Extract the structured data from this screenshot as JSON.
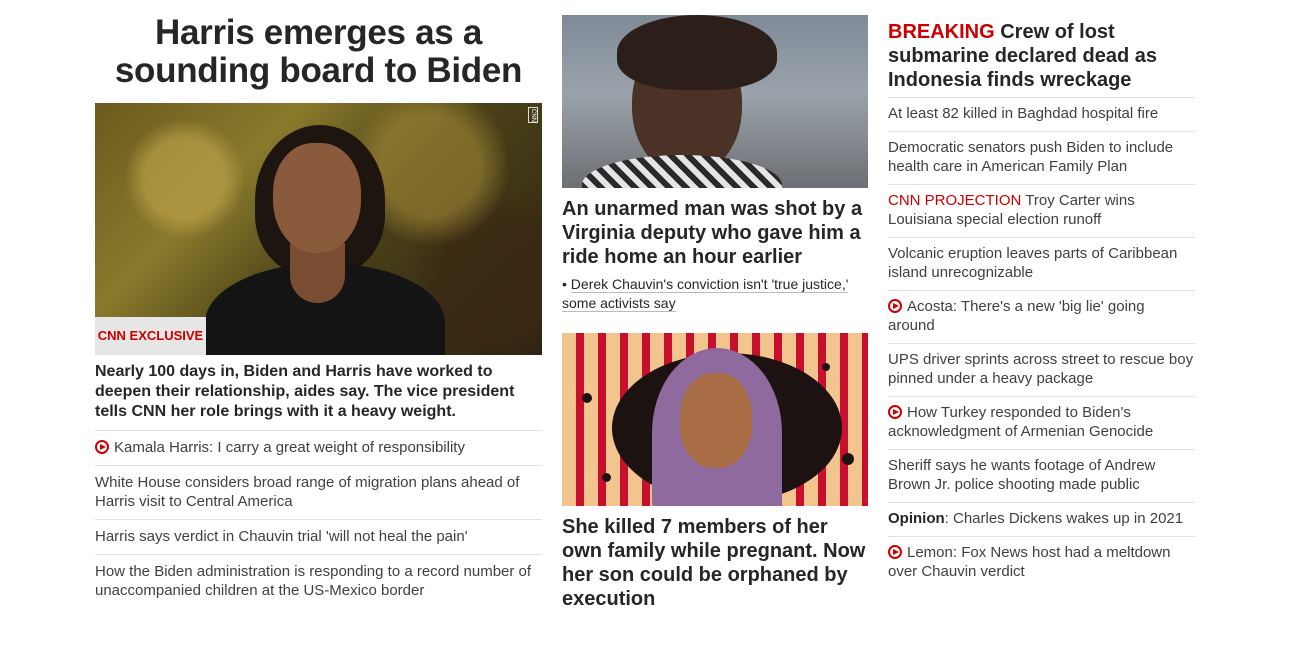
{
  "lead": {
    "headline": "Harris emerges as a sounding board to Biden",
    "image_label": "CNN EXCLUSIVE",
    "image_bug": "CNN",
    "summary": "Nearly 100 days in, Biden and Harris have worked to deepen their relationship, aides say. The vice president tells CNN her role brings with it a heavy weight.",
    "related": [
      {
        "text": "Kamala Harris: I carry a great weight of responsibility",
        "video": true
      },
      {
        "text": "White House considers broad range of migration plans ahead of Harris visit to Central America",
        "video": false
      },
      {
        "text": "Harris says verdict in Chauvin trial 'will not heal the pain'",
        "video": false
      },
      {
        "text": "How the Biden administration is responding to a record number of unaccompanied children at the US-Mexico border",
        "video": false
      }
    ]
  },
  "middle": {
    "story1": {
      "headline": "An unarmed man was shot by a Virginia deputy who gave him a ride home an hour earlier",
      "sub_bullet": "•",
      "sub_link": "Derek Chauvin's conviction isn't 'true justice,' some activists say"
    },
    "story2": {
      "headline": "She killed 7 members of her own family while pregnant. Now her son could be orphaned by execution"
    }
  },
  "right": {
    "breaking_label": "BREAKING",
    "breaking_headline": "Crew of lost submarine declared dead as Indonesia finds wreckage",
    "items": [
      {
        "prefix": "",
        "prefix_style": "",
        "text": "At least 82 killed in Baghdad hospital fire",
        "video": false
      },
      {
        "prefix": "",
        "prefix_style": "",
        "text": "Democratic senators push Biden to include health care in American Family Plan",
        "video": false
      },
      {
        "prefix": "CNN PROJECTION",
        "prefix_style": "red",
        "text": "Troy Carter wins Louisiana special election runoff",
        "video": false
      },
      {
        "prefix": "",
        "prefix_style": "",
        "text": "Volcanic eruption leaves parts of Caribbean island unrecognizable",
        "video": false
      },
      {
        "prefix": "",
        "prefix_style": "",
        "text": "Acosta: There's a new 'big lie' going around",
        "video": true
      },
      {
        "prefix": "",
        "prefix_style": "",
        "text": "UPS driver sprints across street to rescue boy pinned under a heavy package",
        "video": false
      },
      {
        "prefix": "",
        "prefix_style": "",
        "text": "How Turkey responded to Biden's acknowledgment of Armenian Genocide",
        "video": true
      },
      {
        "prefix": "",
        "prefix_style": "",
        "text": "Sheriff says he wants footage of Andrew Brown Jr. police shooting made public",
        "video": false
      },
      {
        "prefix": "Opinion",
        "prefix_style": "bold",
        "text": ": Charles Dickens wakes up in 2021",
        "video": false
      },
      {
        "prefix": "",
        "prefix_style": "",
        "text": "Lemon: Fox News host had a meltdown over Chauvin verdict",
        "video": true
      }
    ]
  },
  "colors": {
    "accent_red": "#cc0000",
    "text": "#262626",
    "divider": "#e0e0e0"
  }
}
